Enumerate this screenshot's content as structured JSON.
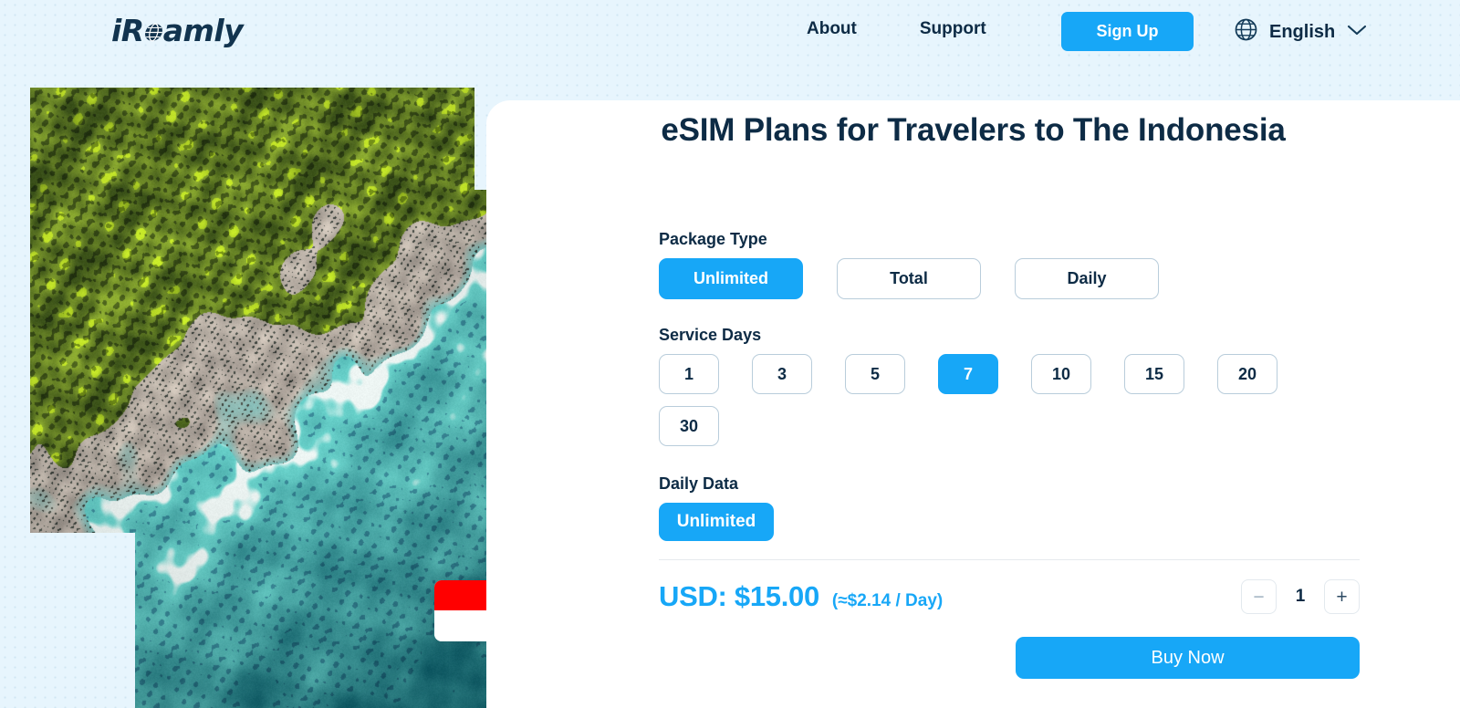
{
  "header": {
    "logo_text_pre": "iR",
    "logo_icon": "globe-o-glyph",
    "logo_text_post": "amly",
    "nav": [
      {
        "label": "About",
        "name": "nav-about"
      },
      {
        "label": "Support",
        "name": "nav-support"
      }
    ],
    "signup_label": "Sign Up",
    "language": {
      "icon": "globe-icon",
      "label": "English",
      "chevron": "chevron-down-icon"
    }
  },
  "hero": {
    "alt": "aerial-view-of-tropical-beach-and-forest",
    "flag_badge": {
      "country": "Indonesia",
      "colors": [
        "#ff0000",
        "#ffffff"
      ]
    }
  },
  "main": {
    "title": "eSIM Plans for Travelers to The Indonesia",
    "package_type": {
      "label": "Package Type",
      "options": [
        {
          "label": "Unlimited",
          "selected": true
        },
        {
          "label": "Total",
          "selected": false
        },
        {
          "label": "Daily",
          "selected": false
        }
      ]
    },
    "service_days": {
      "label": "Service Days",
      "options": [
        {
          "label": "1",
          "selected": false
        },
        {
          "label": "3",
          "selected": false
        },
        {
          "label": "5",
          "selected": false
        },
        {
          "label": "7",
          "selected": true
        },
        {
          "label": "10",
          "selected": false
        },
        {
          "label": "15",
          "selected": false
        },
        {
          "label": "20",
          "selected": false
        },
        {
          "label": "30",
          "selected": false
        }
      ]
    },
    "daily_data": {
      "label": "Daily Data",
      "options": [
        {
          "label": "Unlimited",
          "selected": true
        }
      ]
    },
    "price": {
      "amount_label": "USD: $15.00",
      "per_day_label": "(≈$2.14 / Day)"
    },
    "quantity": {
      "decrement": "−",
      "value": "1",
      "increment": "+"
    },
    "buy_label": "Buy Now"
  },
  "theme": {
    "accent": "#17a7f7",
    "navy": "#0d2b45",
    "page_bg": "#e7f5fd",
    "card_bg": "#ffffff",
    "chip_border": "#b9cddb"
  }
}
